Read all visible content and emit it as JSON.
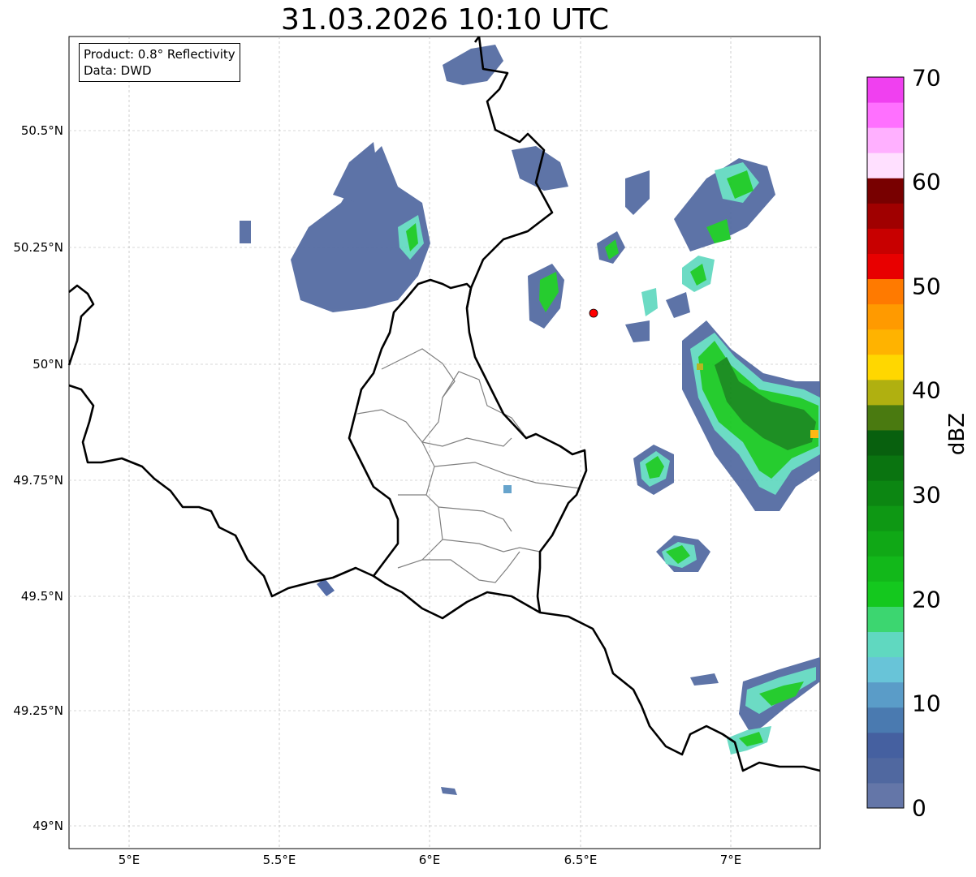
{
  "title": "31.03.2026 10:10 UTC",
  "info_box": {
    "product": "Product: 0.8° Reflectivity",
    "data": "Data: DWD"
  },
  "lon_ticks": [
    "5°E",
    "5.5°E",
    "6°E",
    "6.5°E",
    "7°E"
  ],
  "lat_ticks": [
    "50.5°N",
    "50.25°N",
    "50°N",
    "49.75°N",
    "49.5°N",
    "49.25°N",
    "49°N"
  ],
  "colorbar": {
    "label": "dBZ",
    "ticks": [
      "0",
      "10",
      "20",
      "30",
      "40",
      "50",
      "60",
      "70"
    ],
    "range": [
      0,
      70
    ],
    "colors": [
      "#6476a8",
      "#5068a0",
      "#4560a0",
      "#4a7ab0",
      "#5a9cc8",
      "#68c4d8",
      "#60d8c0",
      "#3cd670",
      "#14c81e",
      "#12b81a",
      "#10a816",
      "#0e9814",
      "#0c8612",
      "#0a7410",
      "#08600e",
      "#4a7a10",
      "#b0b010",
      "#ffd700",
      "#ffb300",
      "#ff9a00",
      "#ff7a00",
      "#e80000",
      "#c80000",
      "#a00000",
      "#780000",
      "#ffe0ff",
      "#ffb0ff",
      "#ff70ff",
      "#f040f0"
    ]
  },
  "colors": {
    "border": "#000000",
    "admin": "#808080",
    "station": "#ff0000"
  }
}
